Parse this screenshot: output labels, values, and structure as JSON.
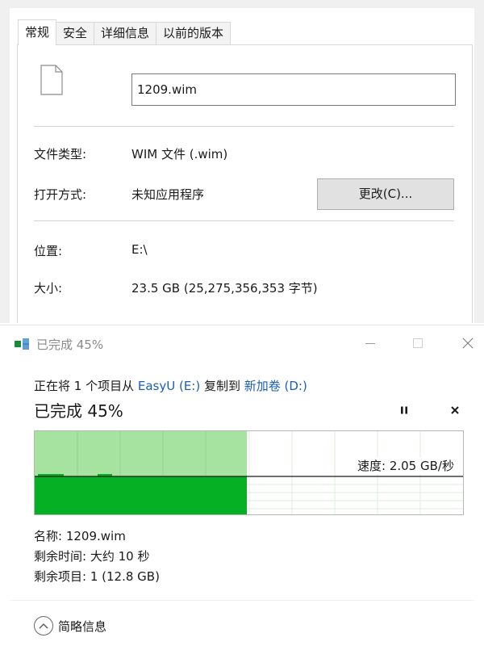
{
  "properties": {
    "tabs": [
      "常规",
      "安全",
      "详细信息",
      "以前的版本"
    ],
    "active_tab": "常规",
    "file_name": "1209.wim",
    "rows": {
      "type_label": "文件类型:",
      "type_value": "WIM 文件 (.wim)",
      "opens_label": "打开方式:",
      "opens_value": "未知应用程序",
      "change_button": "更改(C)...",
      "location_label": "位置:",
      "location_value": "E:\\",
      "size_label": "大小:",
      "size_value": "23.5 GB (25,275,356,353 字节)"
    }
  },
  "copy_dialog": {
    "title": "已完成 45%",
    "copy_prefix": "正在将 1 个项目从 ",
    "source": "EasyU (E:)",
    "copy_middle": " 复制到 ",
    "destination": "新加卷 (D:)",
    "progress_title": "已完成 45%",
    "progress": 0.45,
    "speed": "速度: 2.05 GB/秒",
    "name_line": "名称: 1209.wim",
    "remaining_time": "剩余时间: 大约 10 秒",
    "remaining_items": "剩余项目: 1 (12.8 GB)",
    "details_toggle": "简略信息",
    "colors": {
      "progress_fill": "#a6e3a1",
      "speed_fill": "#06b025",
      "link": "#1a5fb4"
    },
    "icons": [
      "copy-app-icon",
      "minimize-icon",
      "maximize-icon",
      "close-icon",
      "pause-icon",
      "cancel-icon",
      "chevron-up-icon"
    ]
  }
}
